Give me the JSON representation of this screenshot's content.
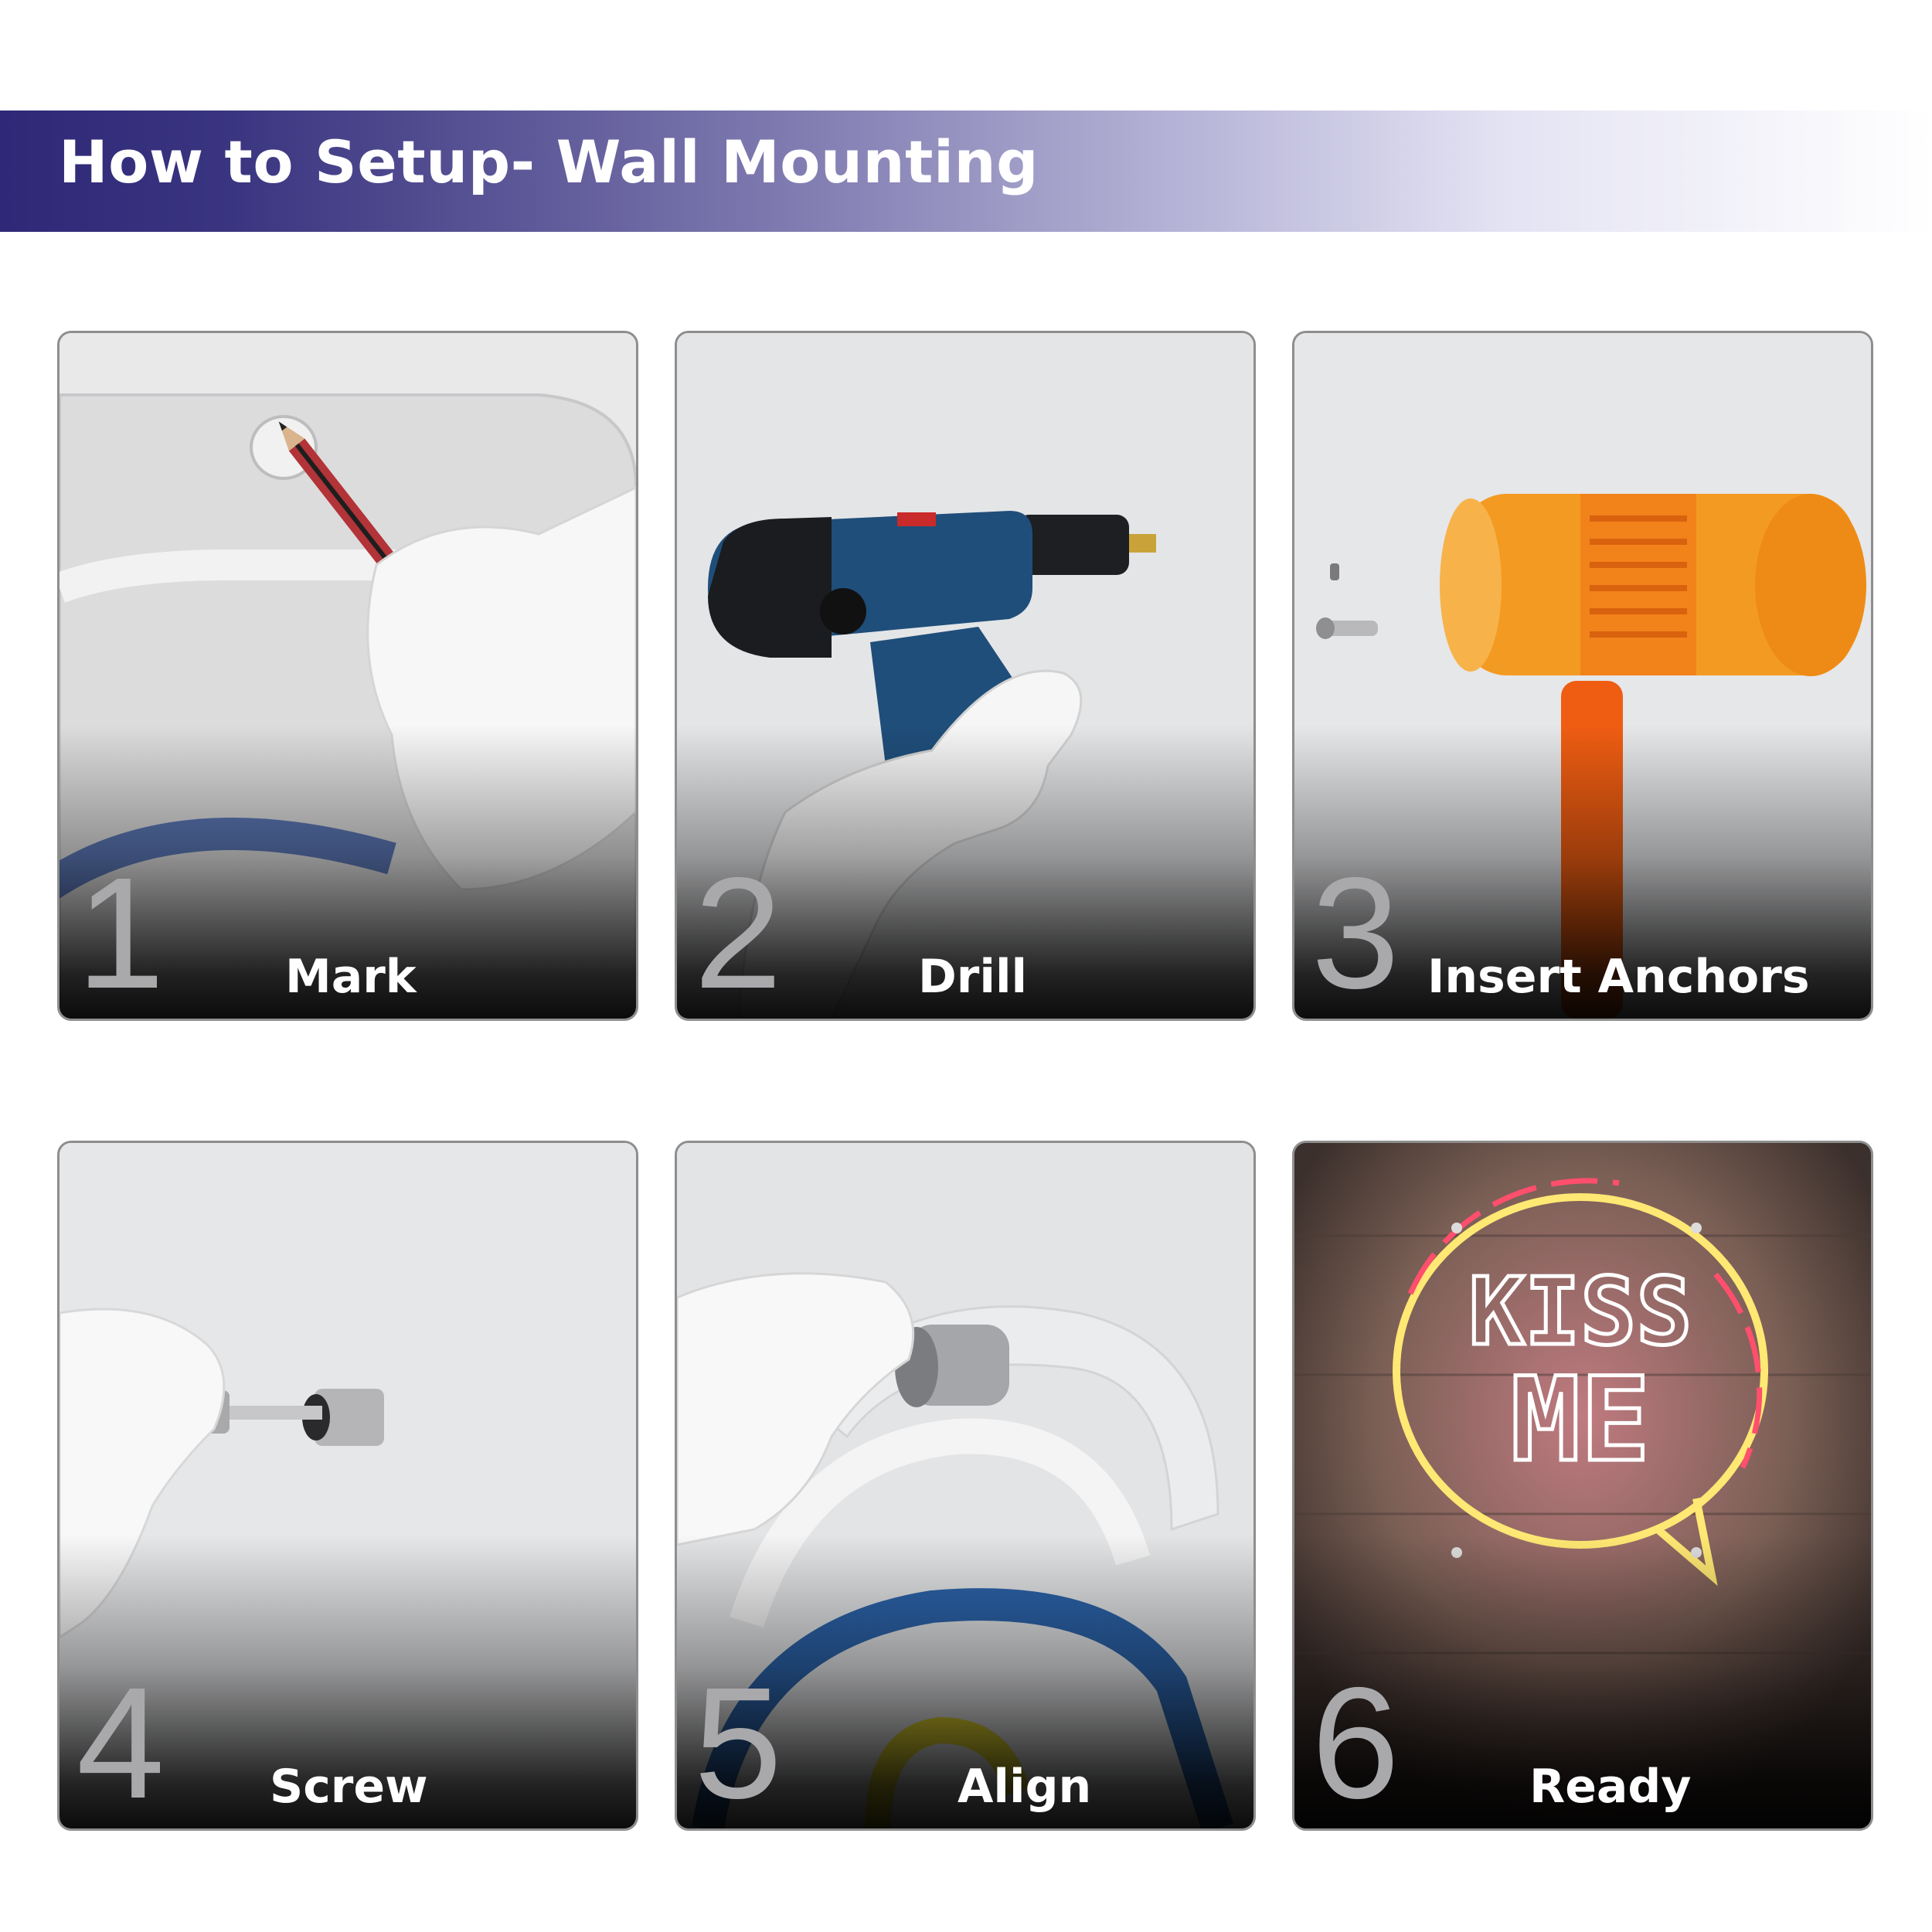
{
  "header": {
    "title": "How to Setup- Wall Mounting"
  },
  "steps": [
    {
      "number": "1",
      "label": "Mark",
      "icon": "pencil-marking-icon"
    },
    {
      "number": "2",
      "label": "Drill",
      "icon": "power-drill-icon"
    },
    {
      "number": "3",
      "label": "Insert Anchors",
      "icon": "mallet-icon"
    },
    {
      "number": "4",
      "label": "Screw",
      "icon": "screwdriver-icon"
    },
    {
      "number": "5",
      "label": "Align",
      "icon": "standoff-align-icon"
    },
    {
      "number": "6",
      "label": "Ready",
      "icon": "neon-sign-icon"
    }
  ],
  "neon_sign": {
    "line1": "KISS",
    "line2": "ME"
  },
  "colors": {
    "banner_start": "#2e2877",
    "banner_end": "#ffffff",
    "label": "#ffffff",
    "number": "#a9a9ac"
  }
}
